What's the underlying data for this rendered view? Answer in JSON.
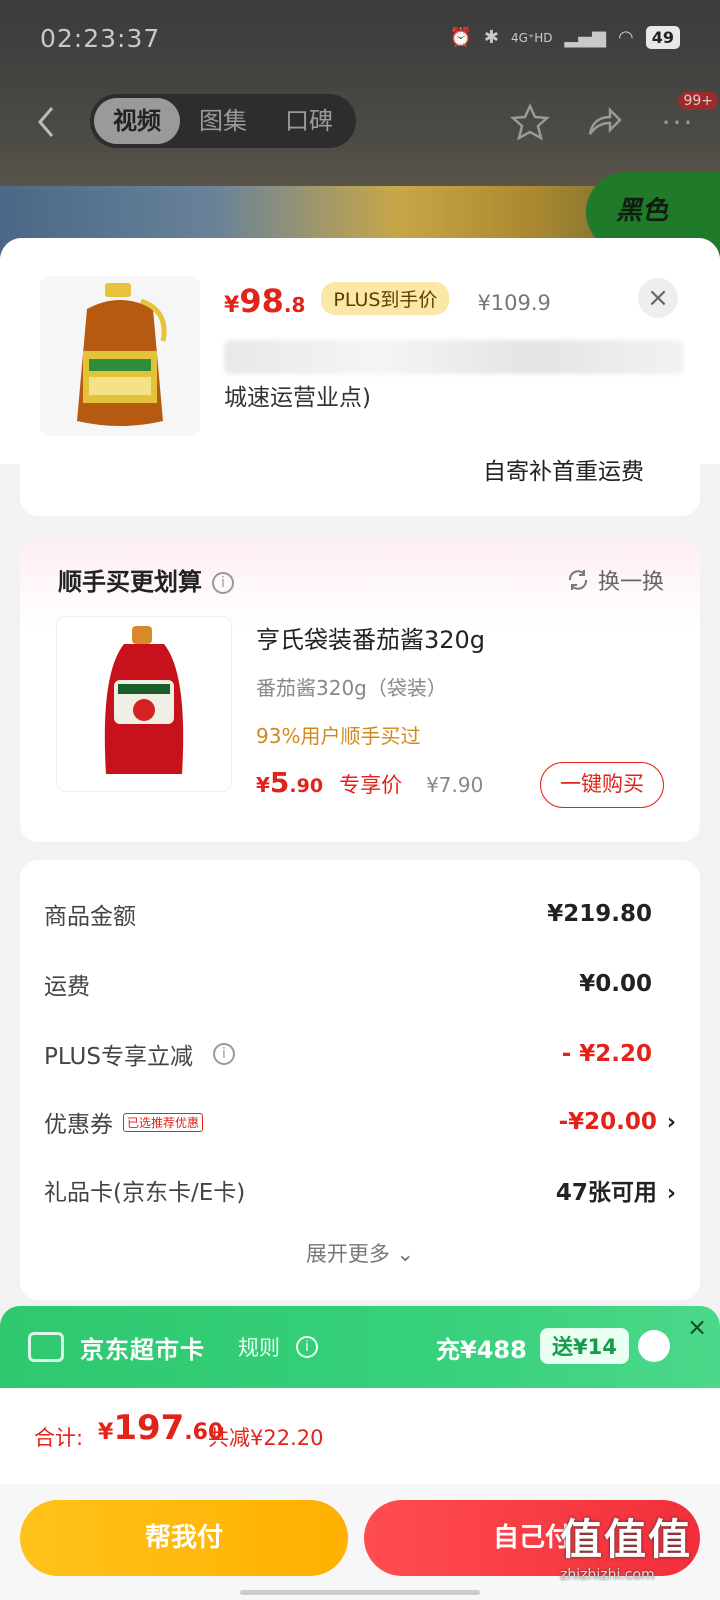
{
  "status_bar": {
    "time": "02:23:37",
    "network": "4G⁺HD",
    "battery": "49"
  },
  "nav": {
    "tabs": [
      "视频",
      "图集",
      "口碑"
    ],
    "active_tab": 0,
    "more_badge": "99+",
    "promo_chip": "黑色"
  },
  "product": {
    "price_currency": "¥",
    "price_int": "98",
    "price_dec": ".8",
    "plus_label": "PLUS到手价",
    "orig_price": "¥109.9",
    "address_tail": "城速运营业点)",
    "shipping_note": "自寄补首重运费"
  },
  "bundle": {
    "title": "顺手买更划算",
    "swap_label": "换一换",
    "name": "亨氏袋装番茄酱320g",
    "spec": "番茄酱320g（袋装）",
    "rate": "93%用户顺手买过",
    "price_currency": "¥",
    "price_int": "5",
    "price_dec": ".90",
    "price_label": "专享价",
    "orig_price": "¥7.90",
    "buy_label": "一键购买"
  },
  "summary": {
    "rows": [
      {
        "label": "商品金额",
        "value": "¥219.80"
      },
      {
        "label": "运费",
        "value": "¥0.00"
      },
      {
        "label": "PLUS专享立减",
        "value": "- ¥2.20"
      },
      {
        "label": "优惠券",
        "tag": "已选推荐优惠",
        "value": "-¥20.00"
      },
      {
        "label": "礼品卡(京东卡/E卡)",
        "value": "47张可用"
      }
    ],
    "expand_label": "展开更多"
  },
  "market_card": {
    "title": "京东超市卡",
    "rule_label": "规则",
    "charge": "充¥488",
    "gift": "送¥14"
  },
  "total": {
    "label": "合计:",
    "currency": "¥",
    "int": "197",
    "dec": ".60",
    "saved": "共减¥22.20"
  },
  "buttons": {
    "help_pay": "帮我付",
    "self_pay": "自己付"
  },
  "watermark": {
    "big": "值值值",
    "small": "zhizhizhi.com"
  },
  "colors": {
    "accent_red": "#e2231a",
    "plus_gold": "#fbe7a6",
    "market_green": "#37d07b",
    "help_yellow": "#ffb000"
  }
}
